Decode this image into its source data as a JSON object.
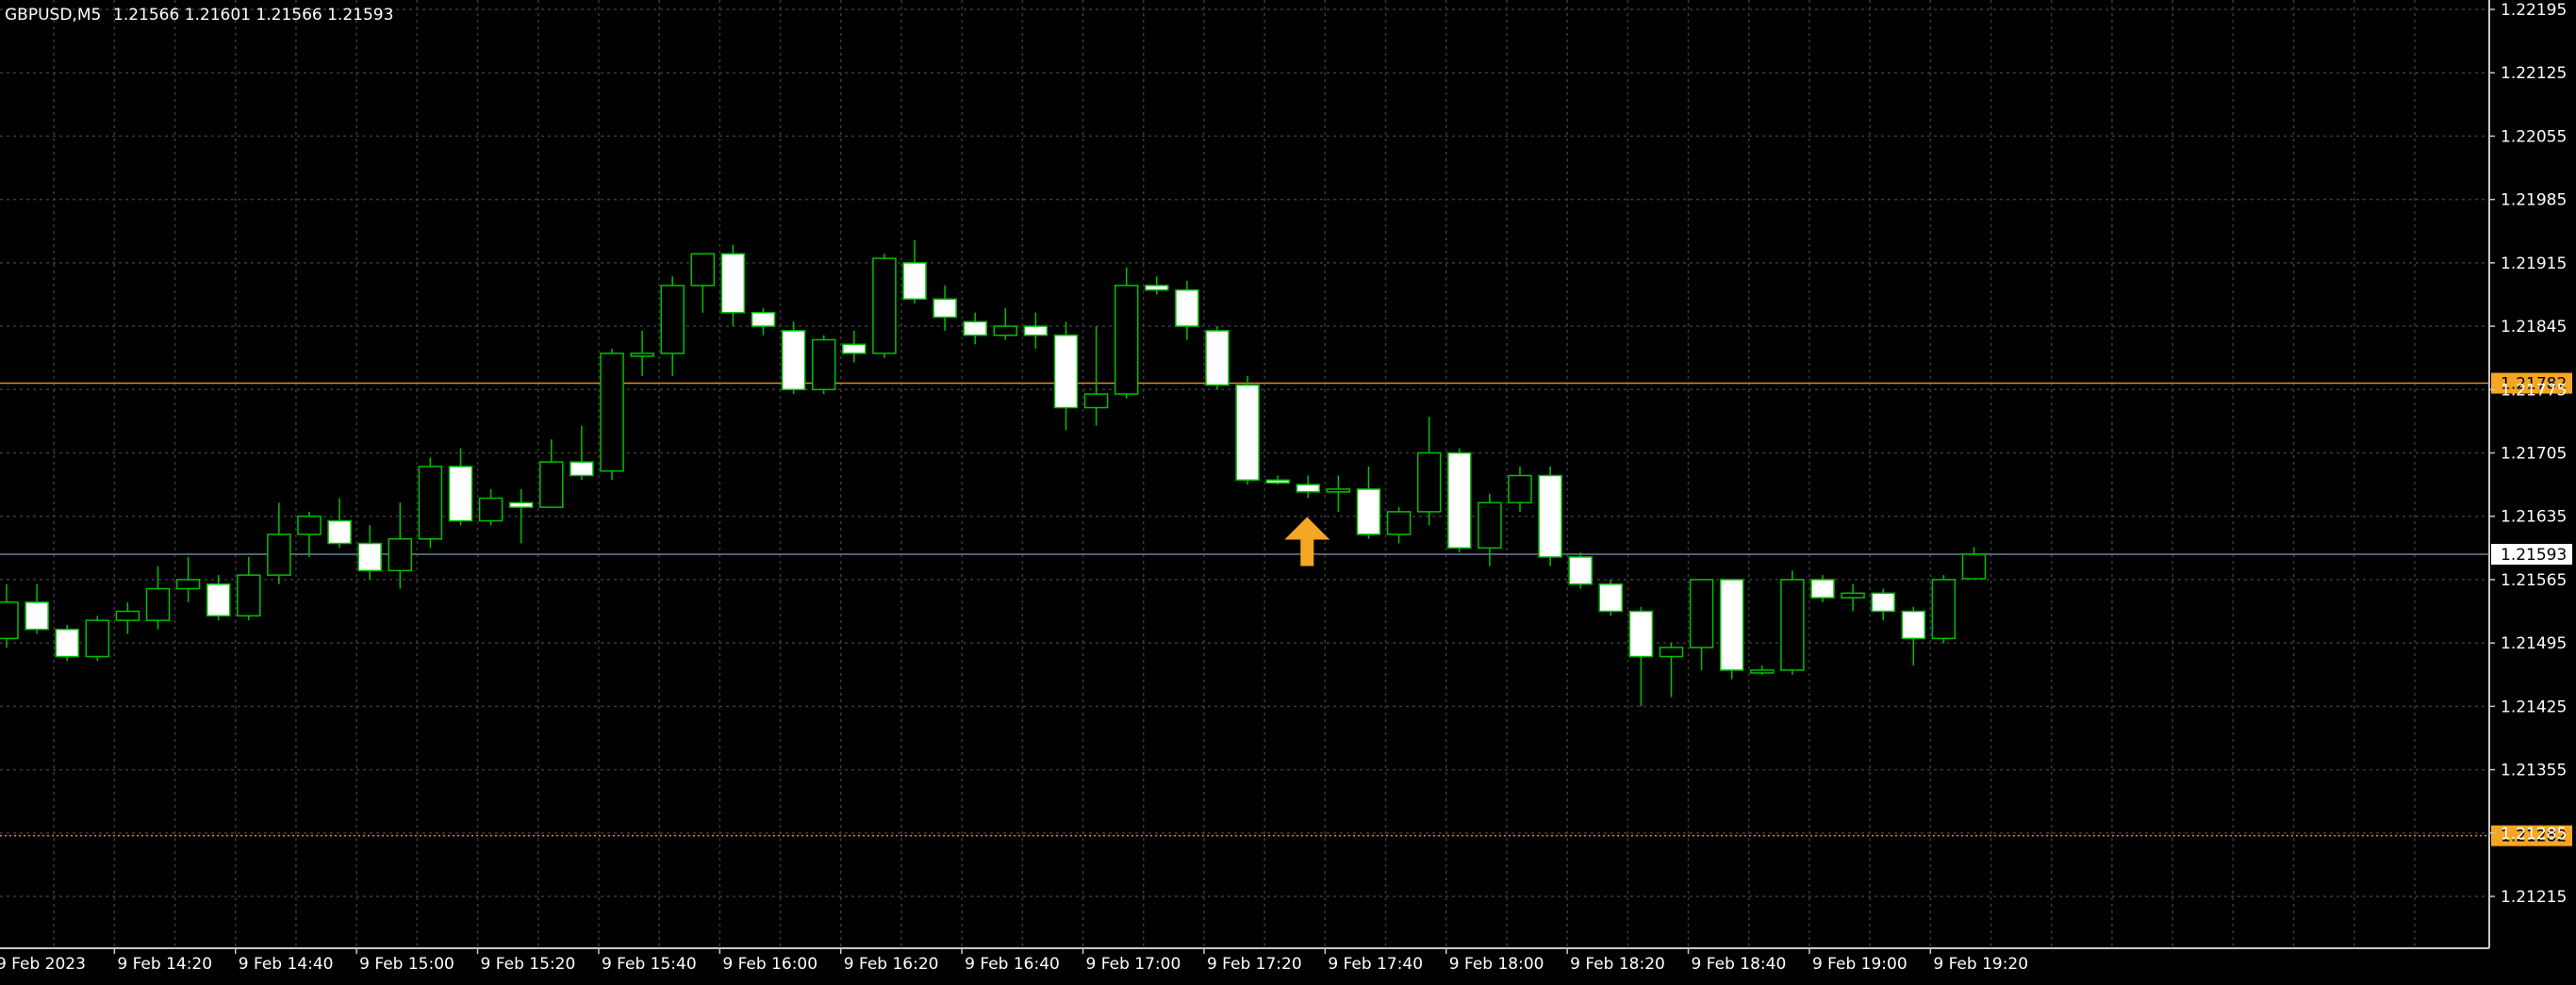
{
  "header": {
    "symbol": "GBPUSD,M5",
    "ohlc": "1.21566 1.21601 1.21566 1.21593"
  },
  "colors": {
    "background": "#000000",
    "grid": "#3a3a3a",
    "axis": "#c8c8c8",
    "text": "#ffffff",
    "bull_outline": "#00c000",
    "bear_fill": "#ffffff",
    "level_line": "#e08a2a",
    "level_label_bg": "#f5a623",
    "bid_line": "#6e7f9a",
    "bid_label_bg": "#ffffff",
    "arrow": "#f5a623"
  },
  "chart_data": {
    "type": "candlestick",
    "symbol": "GBPUSD",
    "timeframe": "M5",
    "ylim": [
      1.2119,
      1.22195
    ],
    "y_ticks": [
      "1.22195",
      "1.22125",
      "1.22055",
      "1.21985",
      "1.21915",
      "1.21845",
      "1.21775",
      "1.21705",
      "1.21635",
      "1.21565",
      "1.21495",
      "1.21425",
      "1.21355",
      "1.21285",
      "1.21215"
    ],
    "x_ticks": [
      {
        "index": 0,
        "label": "9 Feb 2023"
      },
      {
        "index": 4,
        "label": "9 Feb 14:20"
      },
      {
        "index": 8,
        "label": "9 Feb 14:40"
      },
      {
        "index": 12,
        "label": "9 Feb 15:00"
      },
      {
        "index": 16,
        "label": "9 Feb 15:20"
      },
      {
        "index": 20,
        "label": "9 Feb 15:40"
      },
      {
        "index": 24,
        "label": "9 Feb 16:00"
      },
      {
        "index": 28,
        "label": "9 Feb 16:20"
      },
      {
        "index": 32,
        "label": "9 Feb 16:40"
      },
      {
        "index": 36,
        "label": "9 Feb 17:00"
      },
      {
        "index": 40,
        "label": "9 Feb 17:20"
      },
      {
        "index": 44,
        "label": "9 Feb 17:40"
      },
      {
        "index": 48,
        "label": "9 Feb 18:00"
      },
      {
        "index": 52,
        "label": "9 Feb 18:20"
      },
      {
        "index": 56,
        "label": "9 Feb 18:40"
      },
      {
        "index": 60,
        "label": "9 Feb 19:00"
      },
      {
        "index": 64,
        "label": "9 Feb 19:20"
      }
    ],
    "candles": [
      {
        "o": 1.215,
        "h": 1.2156,
        "l": 1.2149,
        "c": 1.2154
      },
      {
        "o": 1.2154,
        "h": 1.2156,
        "l": 1.21505,
        "c": 1.2151
      },
      {
        "o": 1.2151,
        "h": 1.21515,
        "l": 1.21475,
        "c": 1.2148
      },
      {
        "o": 1.2148,
        "h": 1.21525,
        "l": 1.21475,
        "c": 1.2152
      },
      {
        "o": 1.2152,
        "h": 1.2154,
        "l": 1.21505,
        "c": 1.2153
      },
      {
        "o": 1.2152,
        "h": 1.2158,
        "l": 1.2151,
        "c": 1.21555
      },
      {
        "o": 1.21555,
        "h": 1.2159,
        "l": 1.2154,
        "c": 1.21565
      },
      {
        "o": 1.2156,
        "h": 1.2157,
        "l": 1.2152,
        "c": 1.21525
      },
      {
        "o": 1.21525,
        "h": 1.2159,
        "l": 1.2152,
        "c": 1.2157
      },
      {
        "o": 1.2157,
        "h": 1.2165,
        "l": 1.2156,
        "c": 1.21615
      },
      {
        "o": 1.21615,
        "h": 1.2164,
        "l": 1.2159,
        "c": 1.21635
      },
      {
        "o": 1.2163,
        "h": 1.21655,
        "l": 1.216,
        "c": 1.21605
      },
      {
        "o": 1.21605,
        "h": 1.21625,
        "l": 1.21565,
        "c": 1.21575
      },
      {
        "o": 1.21575,
        "h": 1.2165,
        "l": 1.21555,
        "c": 1.2161
      },
      {
        "o": 1.2161,
        "h": 1.217,
        "l": 1.216,
        "c": 1.2169
      },
      {
        "o": 1.2169,
        "h": 1.2171,
        "l": 1.21625,
        "c": 1.2163
      },
      {
        "o": 1.2163,
        "h": 1.21665,
        "l": 1.21625,
        "c": 1.21655
      },
      {
        "o": 1.2165,
        "h": 1.21665,
        "l": 1.21605,
        "c": 1.21645
      },
      {
        "o": 1.21645,
        "h": 1.2172,
        "l": 1.21645,
        "c": 1.21695
      },
      {
        "o": 1.21695,
        "h": 1.21735,
        "l": 1.21675,
        "c": 1.2168
      },
      {
        "o": 1.21685,
        "h": 1.2182,
        "l": 1.21675,
        "c": 1.21815
      },
      {
        "o": 1.21815,
        "h": 1.2184,
        "l": 1.2179,
        "c": 1.21815
      },
      {
        "o": 1.21815,
        "h": 1.219,
        "l": 1.2179,
        "c": 1.2189
      },
      {
        "o": 1.2189,
        "h": 1.21925,
        "l": 1.2186,
        "c": 1.21925
      },
      {
        "o": 1.21925,
        "h": 1.21935,
        "l": 1.21845,
        "c": 1.2186
      },
      {
        "o": 1.2186,
        "h": 1.21865,
        "l": 1.21835,
        "c": 1.21845
      },
      {
        "o": 1.2184,
        "h": 1.2185,
        "l": 1.2177,
        "c": 1.21775
      },
      {
        "o": 1.21775,
        "h": 1.21835,
        "l": 1.2177,
        "c": 1.2183
      },
      {
        "o": 1.21825,
        "h": 1.2184,
        "l": 1.21805,
        "c": 1.21815
      },
      {
        "o": 1.21815,
        "h": 1.21925,
        "l": 1.2181,
        "c": 1.2192
      },
      {
        "o": 1.21915,
        "h": 1.2194,
        "l": 1.2187,
        "c": 1.21875
      },
      {
        "o": 1.21875,
        "h": 1.2189,
        "l": 1.2184,
        "c": 1.21855
      },
      {
        "o": 1.2185,
        "h": 1.2186,
        "l": 1.21825,
        "c": 1.21835
      },
      {
        "o": 1.21835,
        "h": 1.21865,
        "l": 1.2183,
        "c": 1.21845
      },
      {
        "o": 1.21845,
        "h": 1.2186,
        "l": 1.2182,
        "c": 1.21835
      },
      {
        "o": 1.21835,
        "h": 1.2185,
        "l": 1.2173,
        "c": 1.21755
      },
      {
        "o": 1.21755,
        "h": 1.21845,
        "l": 1.21735,
        "c": 1.2177
      },
      {
        "o": 1.2177,
        "h": 1.2191,
        "l": 1.21765,
        "c": 1.2189
      },
      {
        "o": 1.2189,
        "h": 1.219,
        "l": 1.2188,
        "c": 1.21885
      },
      {
        "o": 1.21885,
        "h": 1.21895,
        "l": 1.2183,
        "c": 1.21845
      },
      {
        "o": 1.2184,
        "h": 1.21845,
        "l": 1.21775,
        "c": 1.2178
      },
      {
        "o": 1.2178,
        "h": 1.2179,
        "l": 1.2167,
        "c": 1.21675
      },
      {
        "o": 1.21675,
        "h": 1.2168,
        "l": 1.2167,
        "c": 1.21672
      },
      {
        "o": 1.2167,
        "h": 1.2168,
        "l": 1.21655,
        "c": 1.21662
      },
      {
        "o": 1.21662,
        "h": 1.2168,
        "l": 1.2164,
        "c": 1.21665
      },
      {
        "o": 1.21665,
        "h": 1.2169,
        "l": 1.2161,
        "c": 1.21615
      },
      {
        "o": 1.21615,
        "h": 1.21645,
        "l": 1.21605,
        "c": 1.2164
      },
      {
        "o": 1.2164,
        "h": 1.21745,
        "l": 1.21625,
        "c": 1.21705
      },
      {
        "o": 1.21705,
        "h": 1.2171,
        "l": 1.21595,
        "c": 1.216
      },
      {
        "o": 1.216,
        "h": 1.2166,
        "l": 1.2158,
        "c": 1.2165
      },
      {
        "o": 1.2165,
        "h": 1.2169,
        "l": 1.2164,
        "c": 1.2168
      },
      {
        "o": 1.2168,
        "h": 1.2169,
        "l": 1.2158,
        "c": 1.2159
      },
      {
        "o": 1.2159,
        "h": 1.21595,
        "l": 1.21555,
        "c": 1.2156
      },
      {
        "o": 1.2156,
        "h": 1.21565,
        "l": 1.21525,
        "c": 1.2153
      },
      {
        "o": 1.2153,
        "h": 1.21535,
        "l": 1.21425,
        "c": 1.2148
      },
      {
        "o": 1.2148,
        "h": 1.21495,
        "l": 1.21435,
        "c": 1.2149
      },
      {
        "o": 1.2149,
        "h": 1.21565,
        "l": 1.21465,
        "c": 1.21565
      },
      {
        "o": 1.21565,
        "h": 1.21565,
        "l": 1.21455,
        "c": 1.21465
      },
      {
        "o": 1.21465,
        "h": 1.2147,
        "l": 1.2146,
        "c": 1.21465
      },
      {
        "o": 1.21465,
        "h": 1.21575,
        "l": 1.2146,
        "c": 1.21565
      },
      {
        "o": 1.21565,
        "h": 1.2157,
        "l": 1.2154,
        "c": 1.21545
      },
      {
        "o": 1.21545,
        "h": 1.2156,
        "l": 1.2153,
        "c": 1.2155
      },
      {
        "o": 1.2155,
        "h": 1.21555,
        "l": 1.2152,
        "c": 1.2153
      },
      {
        "o": 1.2153,
        "h": 1.21535,
        "l": 1.2147,
        "c": 1.215
      },
      {
        "o": 1.215,
        "h": 1.2157,
        "l": 1.21495,
        "c": 1.21565
      },
      {
        "o": 1.21566,
        "h": 1.21601,
        "l": 1.21566,
        "c": 1.21593
      }
    ],
    "levels": [
      {
        "name": "level-upper",
        "price": 1.21782,
        "label": "1.21782",
        "style": "solid"
      },
      {
        "name": "level-lower",
        "price": 1.21282,
        "label": "1.21282",
        "style": "dotted"
      }
    ],
    "bid": {
      "price": 1.21593,
      "label": "1.21593"
    },
    "buy_arrow": {
      "index": 43,
      "price": 1.2163
    }
  }
}
